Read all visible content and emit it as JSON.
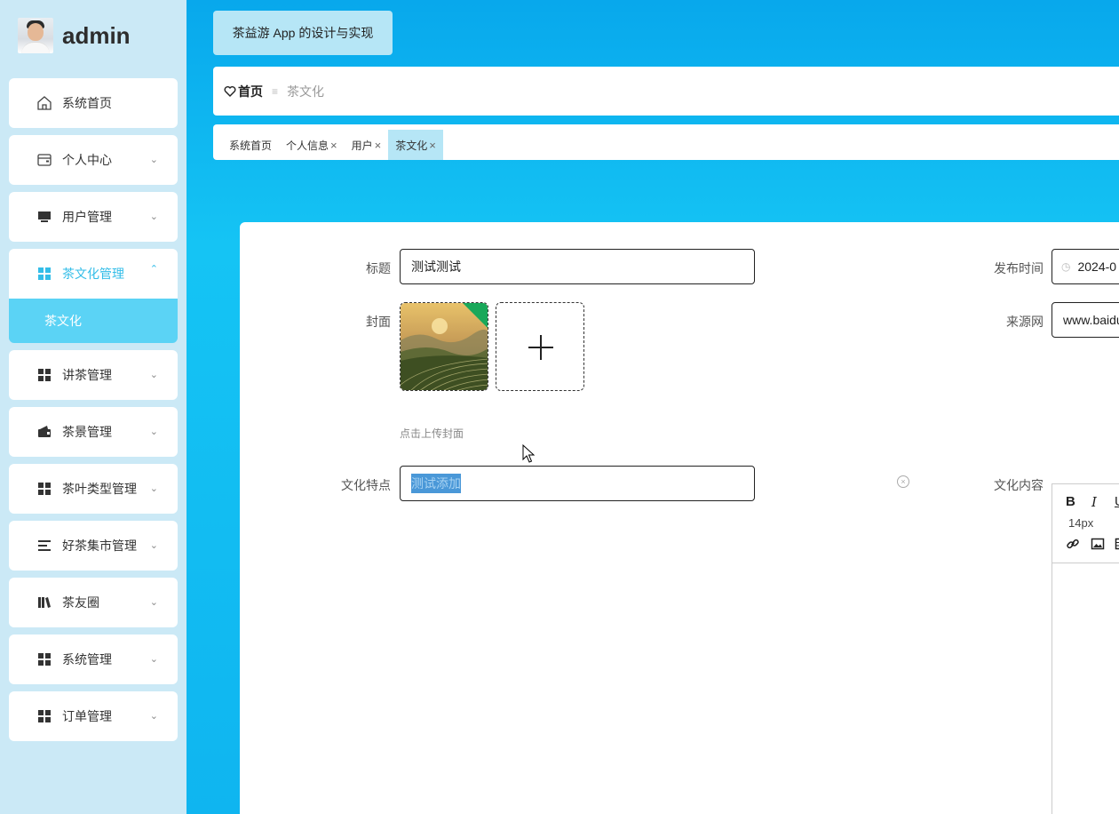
{
  "user": {
    "name": "admin"
  },
  "sidebar": {
    "items": [
      {
        "label": "系统首页",
        "icon": "home-icon"
      },
      {
        "label": "个人中心",
        "icon": "wallet-icon"
      },
      {
        "label": "用户管理",
        "icon": "monitor-icon"
      },
      {
        "label": "茶文化管理",
        "icon": "grid-icon",
        "active": true,
        "sub": [
          {
            "label": "茶文化"
          }
        ]
      },
      {
        "label": "讲茶管理",
        "icon": "grid-icon"
      },
      {
        "label": "茶景管理",
        "icon": "wallet-icon"
      },
      {
        "label": "茶叶类型管理",
        "icon": "grid-icon"
      },
      {
        "label": "好茶集市管理",
        "icon": "list-icon"
      },
      {
        "label": "茶友圈",
        "icon": "book-icon"
      },
      {
        "label": "系统管理",
        "icon": "grid-icon"
      },
      {
        "label": "订单管理",
        "icon": "grid-icon"
      }
    ]
  },
  "header": {
    "app_title": "茶益游 App 的设计与实现"
  },
  "breadcrumb": {
    "home": "首页",
    "current": "茶文化"
  },
  "tabs": [
    {
      "label": "系统首页",
      "closable": false
    },
    {
      "label": "个人信息",
      "closable": true
    },
    {
      "label": "用户",
      "closable": true
    },
    {
      "label": "茶文化",
      "closable": true,
      "active": true
    }
  ],
  "form": {
    "title_label": "标题",
    "title_value": "测试测试",
    "publish_time_label": "发布时间",
    "publish_time_value": "2024-0",
    "cover_label": "封面",
    "cover_hint": "点击上传封面",
    "source_label": "来源网",
    "source_value": "www.baidu",
    "feature_label": "文化特点",
    "feature_value": "测试添加",
    "content_label": "文化内容",
    "editor_font_size": "14px"
  },
  "colors": {
    "accent": "#33bde8",
    "active_sub": "#5bd3f5",
    "sidebar_bg": "#cbe9f6"
  }
}
